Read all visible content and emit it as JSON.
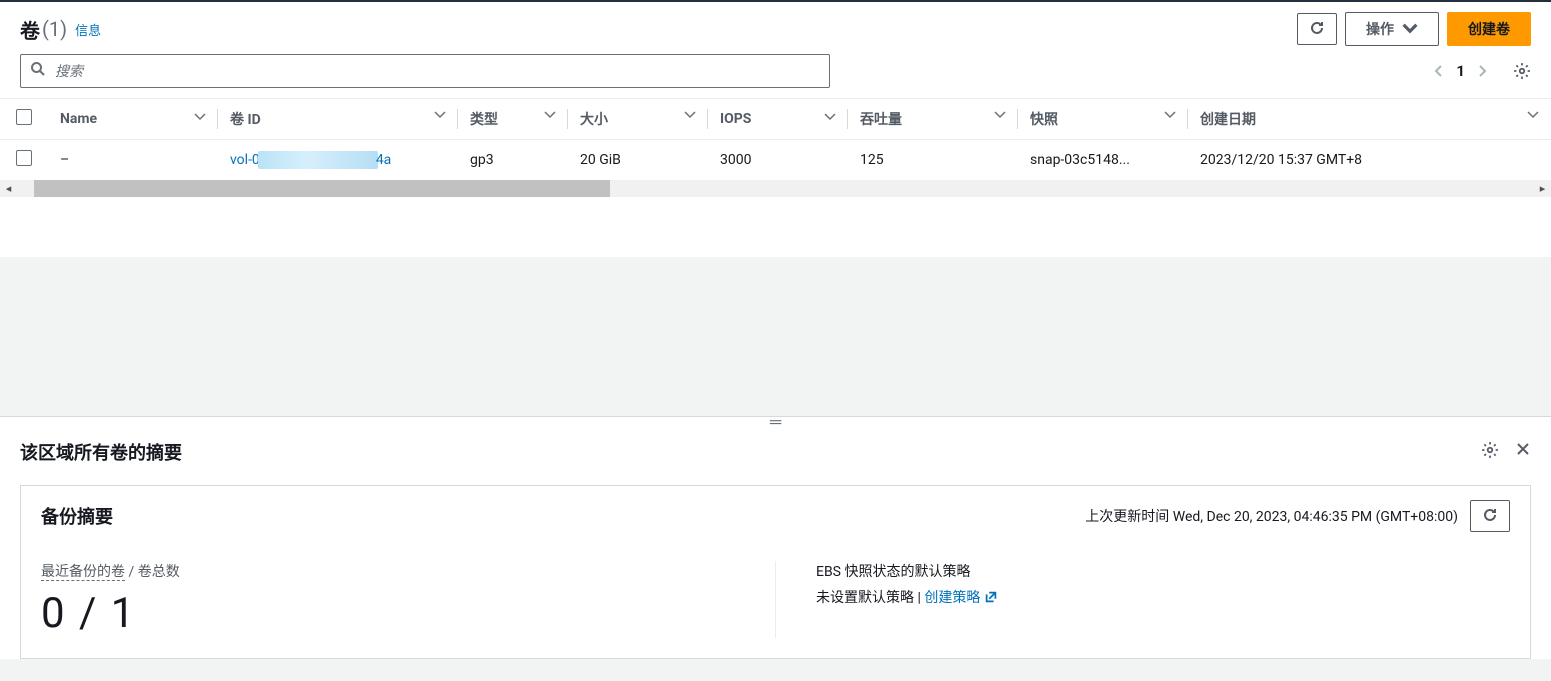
{
  "header": {
    "title": "卷",
    "count_display": "(1)",
    "info_label": "信息",
    "actions_label": "操作",
    "create_label": "创建卷"
  },
  "search": {
    "placeholder": "搜索"
  },
  "pager": {
    "page": "1"
  },
  "table": {
    "columns": {
      "name": "Name",
      "volume_id": "卷 ID",
      "type": "类型",
      "size": "大小",
      "iops": "IOPS",
      "throughput": "吞吐量",
      "snapshot": "快照",
      "created": "创建日期"
    },
    "row": {
      "name": "–",
      "volume_id_prefix": "vol-0",
      "volume_id_suffix": "4a",
      "type": "gp3",
      "size": "20 GiB",
      "iops": "3000",
      "throughput": "125",
      "snapshot": "snap-03c5148...",
      "created": "2023/12/20 15:37 GMT+8"
    }
  },
  "summary": {
    "title": "该区域所有卷的摘要",
    "panel_title": "备份摘要",
    "last_updated_prefix": "上次更新时间 ",
    "last_updated_time": "Wed, Dec 20, 2023, 04:46:35 PM (GMT+08:00)",
    "left": {
      "label_dotted": "最近备份的卷",
      "label_sep": " / ",
      "label_tail": "卷总数",
      "big": "0 / 1"
    },
    "right": {
      "line1": "EBS 快照状态的默认策略",
      "no_policy": "未设置默认策略",
      "sep": " | ",
      "create_policy": "创建策略"
    }
  }
}
